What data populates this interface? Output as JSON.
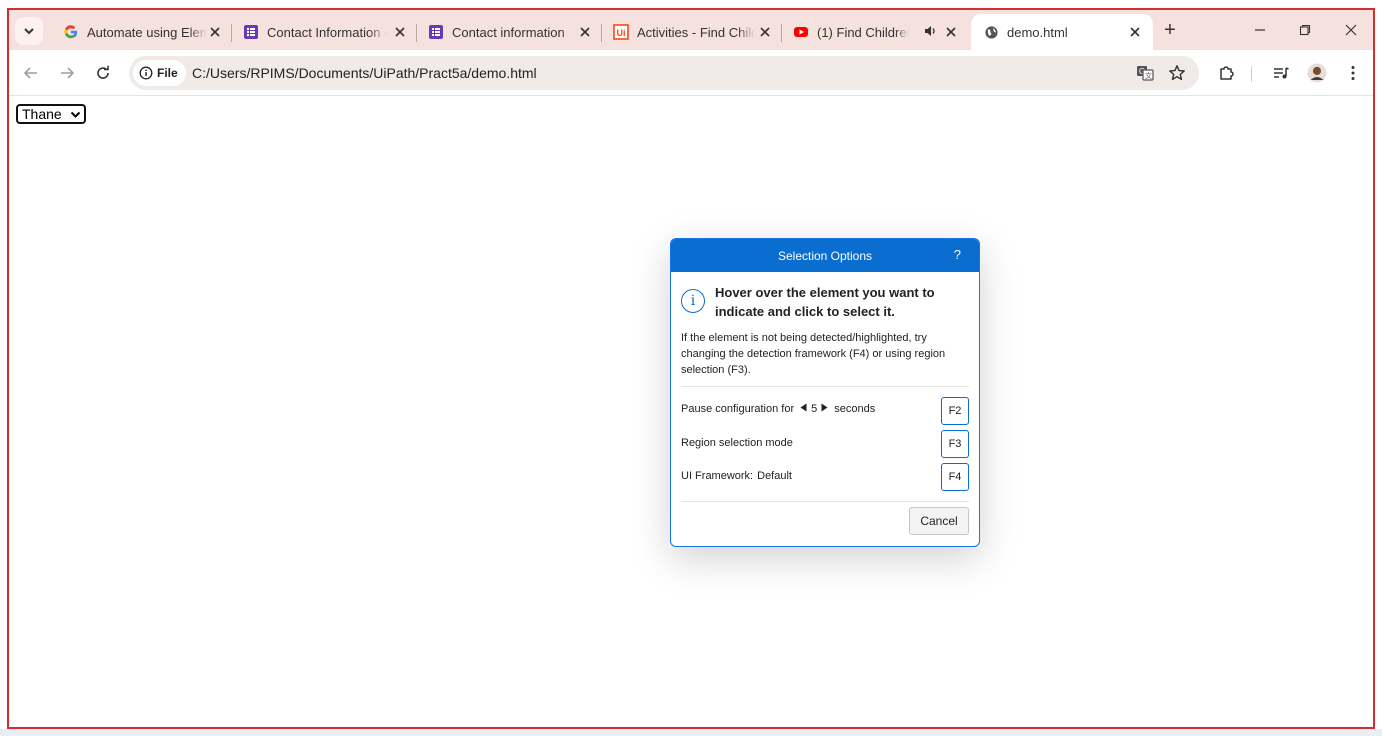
{
  "browser": {
    "tabs": [
      {
        "title": "Automate using Elem",
        "icon": "google-icon"
      },
      {
        "title": "Contact Information -",
        "icon": "forms-icon"
      },
      {
        "title": "Contact information",
        "icon": "forms-icon"
      },
      {
        "title": "Activities - Find Child",
        "icon": "uipath-icon"
      },
      {
        "title": "(1) Find Children",
        "icon": "youtube-icon"
      },
      {
        "title": "demo.html",
        "icon": "globe-icon"
      }
    ],
    "new_tab_label": "+",
    "site_chip": "File",
    "url": "C:/Users/RPIMS/Documents/UiPath/Pract5a/demo.html"
  },
  "page": {
    "select_value": "Thane"
  },
  "dialog": {
    "title": "Selection Options",
    "help": "?",
    "heading": "Hover over the element you want to indicate and click to select it.",
    "description": "If the element is not being detected/highlighted, try changing the detection framework (F4) or using region selection (F3).",
    "pause_prefix": "Pause configuration for",
    "pause_seconds": "5",
    "pause_suffix": "seconds",
    "pause_key": "F2",
    "region_label": "Region selection mode",
    "region_key": "F3",
    "framework_label": "UI Framework:",
    "framework_value": "Default",
    "framework_key": "F4",
    "cancel_label": "Cancel"
  },
  "colors": {
    "accent": "#0a6ed1",
    "frame_border": "#d32f2f",
    "titlebar": "#f5e1de"
  }
}
